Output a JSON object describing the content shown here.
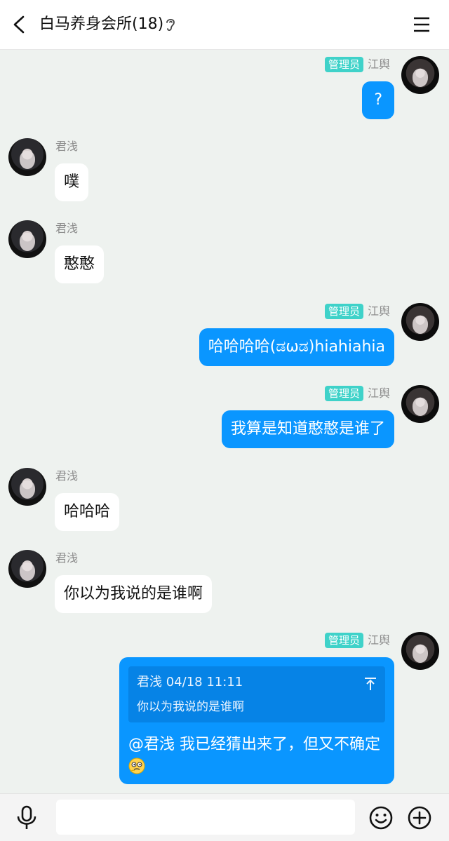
{
  "header": {
    "title": "白马养身会所(18)",
    "icons": {
      "back": "back-arrow-icon",
      "ear": "ear-icon",
      "menu": "menu-icon"
    }
  },
  "colors": {
    "background": "#eef2ef",
    "self_bubble": "#0a96ff",
    "other_bubble": "#ffffff",
    "admin_badge": "#3fd2c9"
  },
  "messages": [
    {
      "side": "right",
      "sender": "江舆",
      "badge": "管理员",
      "text": "?"
    },
    {
      "side": "left",
      "sender": "君浅",
      "text": "噗"
    },
    {
      "side": "left",
      "sender": "君浅",
      "text": "憨憨"
    },
    {
      "side": "right",
      "sender": "江舆",
      "badge": "管理员",
      "text": "哈哈哈哈(ಡωಡ)hiahiahia"
    },
    {
      "side": "right",
      "sender": "江舆",
      "badge": "管理员",
      "text": "我算是知道憨憨是谁了"
    },
    {
      "side": "left",
      "sender": "君浅",
      "text": "哈哈哈"
    },
    {
      "side": "left",
      "sender": "君浅",
      "text": "你以为我说的是谁啊"
    },
    {
      "side": "right",
      "sender": "江舆",
      "badge": "管理员",
      "quote": {
        "header": "君浅 04/18 11:11",
        "text": "你以为我说的是谁啊"
      },
      "text": "@君浅 我已经猜出来了，但又不确定",
      "emoji": "thinking-face-icon"
    }
  ],
  "input_bar": {
    "placeholder": "",
    "icons": {
      "voice": "microphone-icon",
      "emoji": "smile-icon",
      "more": "plus-circle-icon"
    }
  }
}
